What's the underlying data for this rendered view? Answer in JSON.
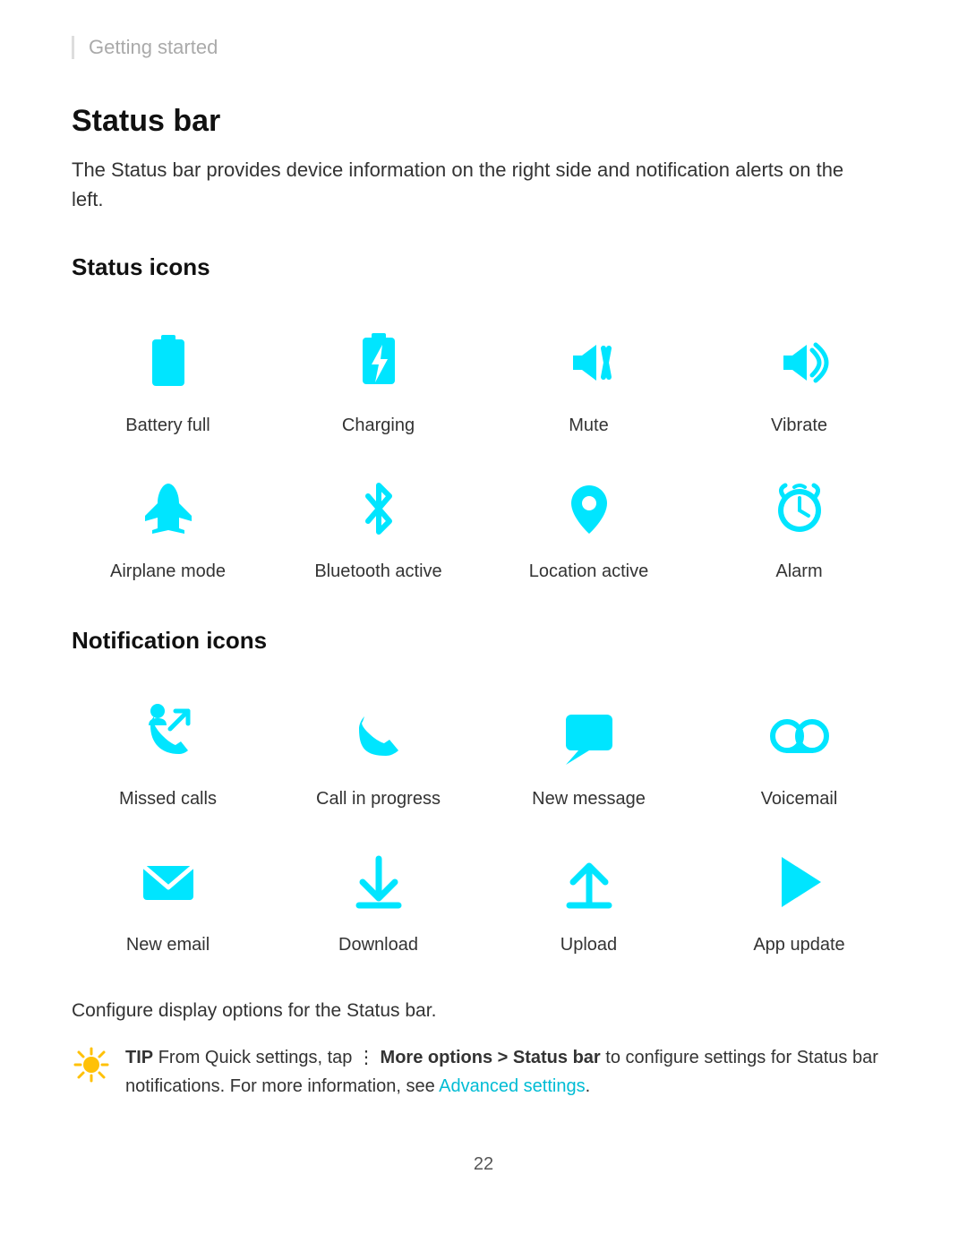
{
  "breadcrumb": "Getting started",
  "section": {
    "title": "Status bar",
    "description": "The Status bar provides device information on the right side and notification alerts on the left."
  },
  "status_icons": {
    "heading": "Status icons",
    "items": [
      {
        "id": "battery-full",
        "label": "Battery full"
      },
      {
        "id": "charging",
        "label": "Charging"
      },
      {
        "id": "mute",
        "label": "Mute"
      },
      {
        "id": "vibrate",
        "label": "Vibrate"
      },
      {
        "id": "airplane-mode",
        "label": "Airplane mode"
      },
      {
        "id": "bluetooth-active",
        "label": "Bluetooth active"
      },
      {
        "id": "location-active",
        "label": "Location active"
      },
      {
        "id": "alarm",
        "label": "Alarm"
      }
    ]
  },
  "notification_icons": {
    "heading": "Notification icons",
    "items": [
      {
        "id": "missed-calls",
        "label": "Missed calls"
      },
      {
        "id": "call-in-progress",
        "label": "Call in progress"
      },
      {
        "id": "new-message",
        "label": "New message"
      },
      {
        "id": "voicemail",
        "label": "Voicemail"
      },
      {
        "id": "new-email",
        "label": "New email"
      },
      {
        "id": "download",
        "label": "Download"
      },
      {
        "id": "upload",
        "label": "Upload"
      },
      {
        "id": "app-update",
        "label": "App update"
      }
    ]
  },
  "configure_text": "Configure display options for the Status bar.",
  "tip": {
    "label": "TIP",
    "text_before": "From Quick settings, tap",
    "bold_part": "More options > Status bar",
    "text_after": "to configure settings for Status bar notifications. For more information, see",
    "link_text": "Advanced settings",
    "text_end": "."
  },
  "page_number": "22"
}
